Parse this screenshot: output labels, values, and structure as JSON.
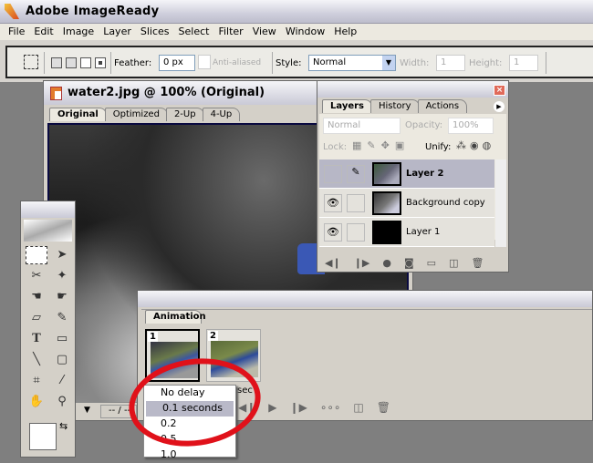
{
  "app": {
    "title": "Adobe ImageReady"
  },
  "menu": [
    "File",
    "Edit",
    "Image",
    "Layer",
    "Slices",
    "Select",
    "Filter",
    "View",
    "Window",
    "Help"
  ],
  "options": {
    "feather_label": "Feather:",
    "feather_value": "0 px",
    "antialiased_label": "Anti-aliased",
    "style_label": "Style:",
    "style_value": "Normal",
    "width_label": "Width:",
    "width_value": "1",
    "height_label": "Height:",
    "height_value": "1"
  },
  "document": {
    "title": "water2.jpg @ 100% (Original)",
    "tabs": [
      "Original",
      "Optimized",
      "2-Up",
      "4-Up"
    ],
    "active_tab": "Original",
    "status": "-- / --"
  },
  "layers_palette": {
    "tabs": [
      "Layers",
      "History",
      "Actions"
    ],
    "blend_mode": "Normal",
    "opacity_label": "Opacity:",
    "opacity_value": "100%",
    "lock_label": "Lock:",
    "unify_label": "Unify:",
    "layers": [
      {
        "name": "Layer 2",
        "selected": true,
        "visible": false
      },
      {
        "name": "Background copy",
        "selected": false,
        "visible": true
      },
      {
        "name": "Layer 1",
        "selected": false,
        "visible": true
      }
    ]
  },
  "animation_palette": {
    "tab": "Animation",
    "frames": [
      "1",
      "2"
    ],
    "delay_partial": "sec"
  },
  "delay_menu": {
    "items": [
      "No delay",
      "0.1 seconds",
      "0.2",
      "0.5",
      "1.0"
    ],
    "highlighted": "0.1 seconds"
  },
  "colors": {
    "annotation": "#e0111a",
    "highlight": "#b9b9c8"
  }
}
